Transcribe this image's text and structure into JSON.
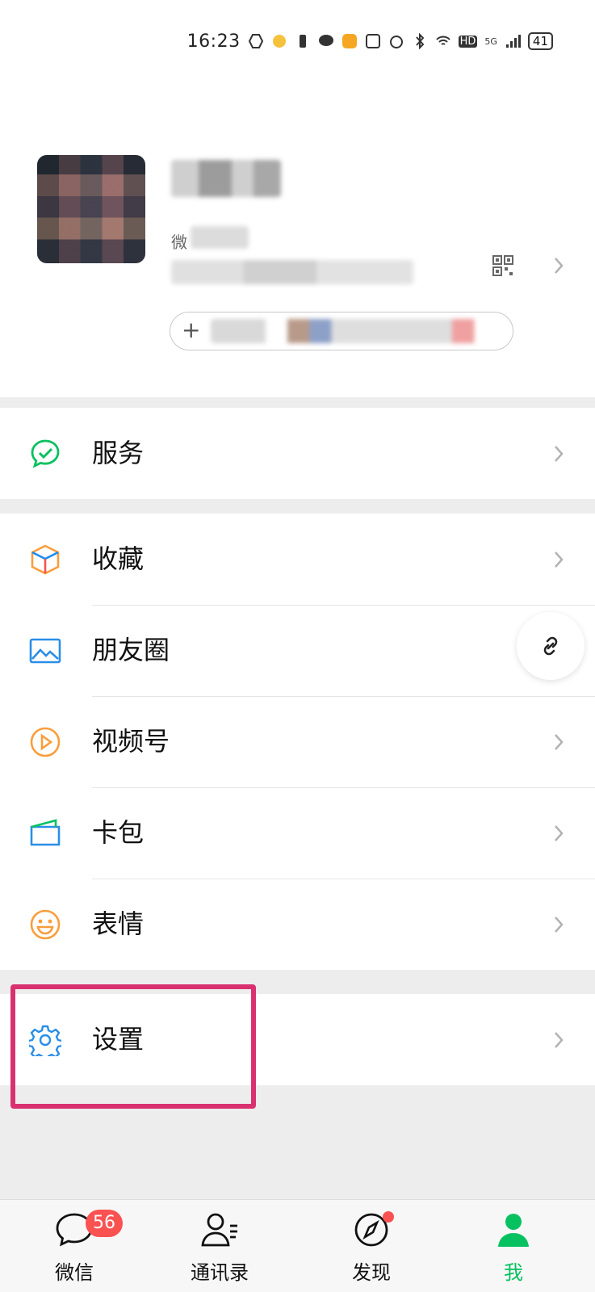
{
  "status_bar": {
    "time": "16:23",
    "network": "5G",
    "hd": "HD",
    "battery": "41"
  },
  "profile": {
    "id_prefix": "微"
  },
  "menu": {
    "service": "服务",
    "favorites": "收藏",
    "moments": "朋友圈",
    "channels": "视频号",
    "cards": "卡包",
    "stickers": "表情",
    "settings": "设置"
  },
  "tabs": {
    "chats": {
      "label": "微信",
      "badge": "56"
    },
    "contacts": {
      "label": "通讯录"
    },
    "discover": {
      "label": "发现"
    },
    "me": {
      "label": "我"
    }
  },
  "colors": {
    "accent": "#07c160",
    "badge": "#fa5151",
    "highlight": "#d9316f"
  }
}
